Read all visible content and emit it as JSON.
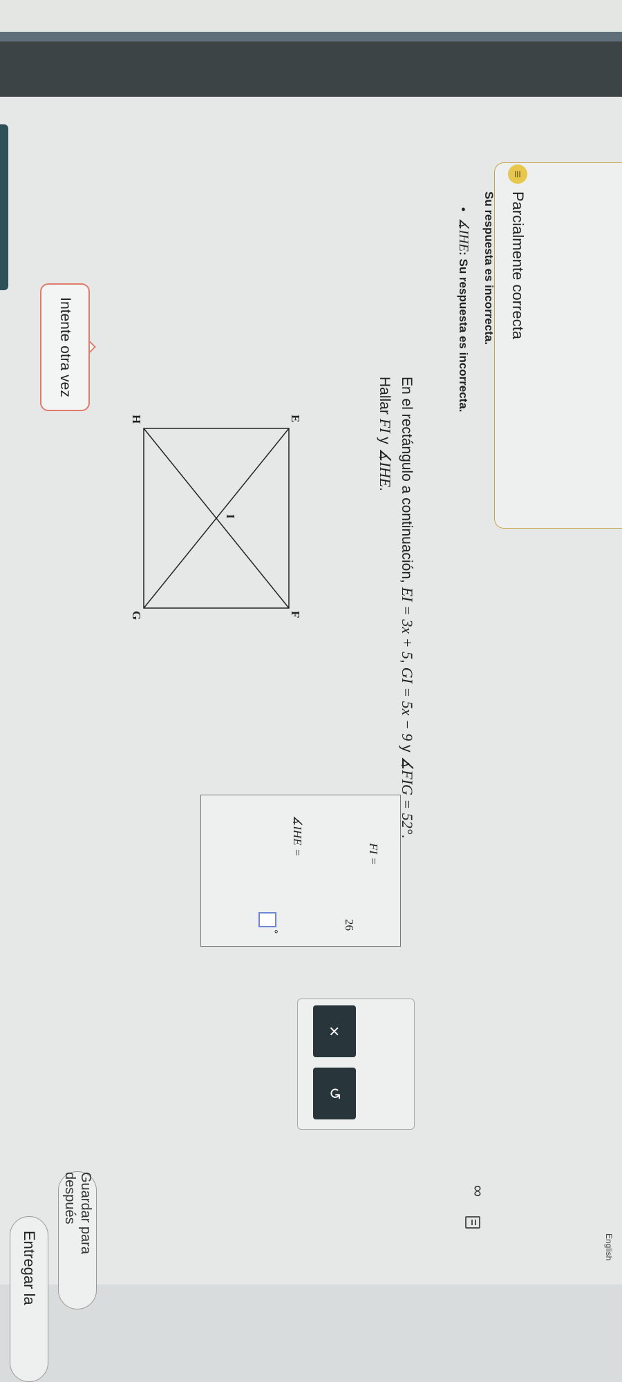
{
  "header": {
    "language_link": "English"
  },
  "feedback": {
    "status": "Parcialmente correcta",
    "message": "Su respuesta es incorrecta.",
    "bullet_label": "∡IHE",
    "bullet_message": ": Su respuesta es incorrecta."
  },
  "problem": {
    "intro": "En el rectángulo a continuación, ",
    "eq1": "EI = 3x + 5",
    "eq2": "GI = 5x − 9",
    "conj": "y",
    "eq3": "∡FIG = 52°",
    "task_prefix": "Hallar ",
    "task_fi": "FI",
    "task_and": "y",
    "task_angle": "∡IHE"
  },
  "diagram": {
    "labels": {
      "E": "E",
      "F": "F",
      "G": "G",
      "H": "H",
      "I": "I"
    }
  },
  "answers": {
    "fi_label": "FI  =",
    "fi_value": "26",
    "angle_label": "∡IHE  =",
    "angle_value": "",
    "degree": "°"
  },
  "buttons": {
    "retry": "Intente otra vez",
    "clear_icon": "×",
    "undo_icon": "↺",
    "save": "Guardar para después",
    "submit": "Entregar la"
  },
  "icons": {
    "infinity": "∞",
    "status": "≡"
  },
  "colors": {
    "accent_border": "#c8a24a",
    "retry_border": "#e27b6d",
    "dark_button": "#28363b",
    "input_border": "#6c86d8"
  }
}
